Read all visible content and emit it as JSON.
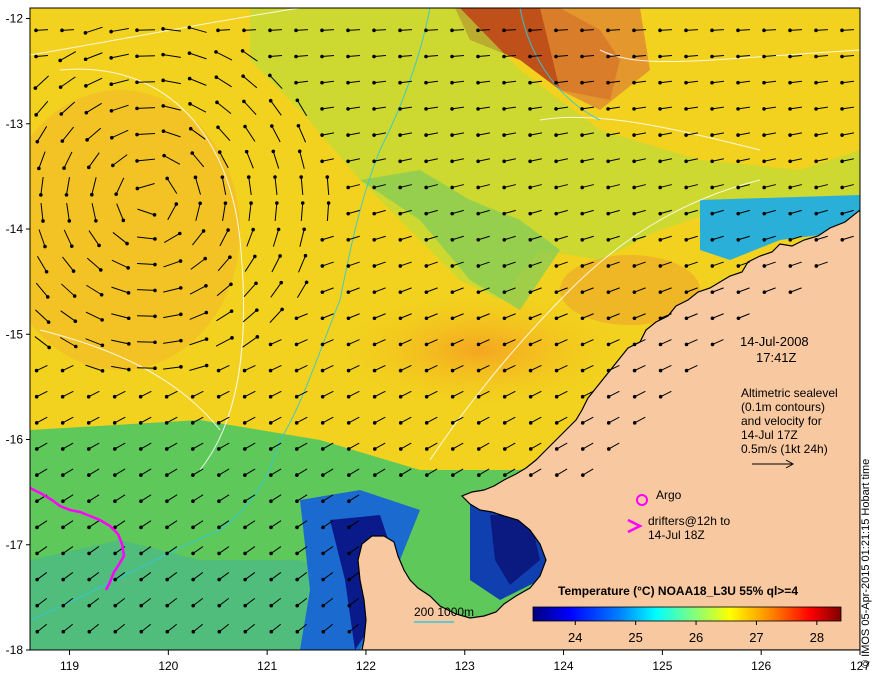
{
  "map": {
    "x_ticks": [
      "119",
      "120",
      "121",
      "122",
      "123",
      "124",
      "125",
      "126",
      "127"
    ],
    "y_ticks": [
      "-12",
      "-13",
      "-14",
      "-15",
      "-16",
      "-17",
      "-18"
    ],
    "date": "14-Jul-2008",
    "time": "17:41Z",
    "altimetry_note": [
      "Altimetric sealevel",
      "(0.1m contours)",
      "and velocity for",
      "14-Jul 17Z",
      "0.5m/s (1kt 24h)"
    ],
    "argo_label": "Argo",
    "drifters_label": [
      "drifters@12h to",
      "14-Jul 18Z"
    ],
    "scale_label": "200  1000m",
    "credit": "© IMOS 05-Apr-2015 01:21:15 Hobart time",
    "land_color": "#f8c8a0",
    "drifter_color": "#ff00ff"
  },
  "colorbar": {
    "title": "Temperature (°C) NOAA18_L3U 55% ql>=4",
    "ticks": [
      "24",
      "25",
      "26",
      "27",
      "28"
    ],
    "range": [
      23.3,
      28.4
    ],
    "colors": [
      "#00007f",
      "#0000ff",
      "#007fff",
      "#00ffff",
      "#7fff7f",
      "#ffff00",
      "#ff7f00",
      "#ff0000",
      "#7f0000"
    ]
  }
}
